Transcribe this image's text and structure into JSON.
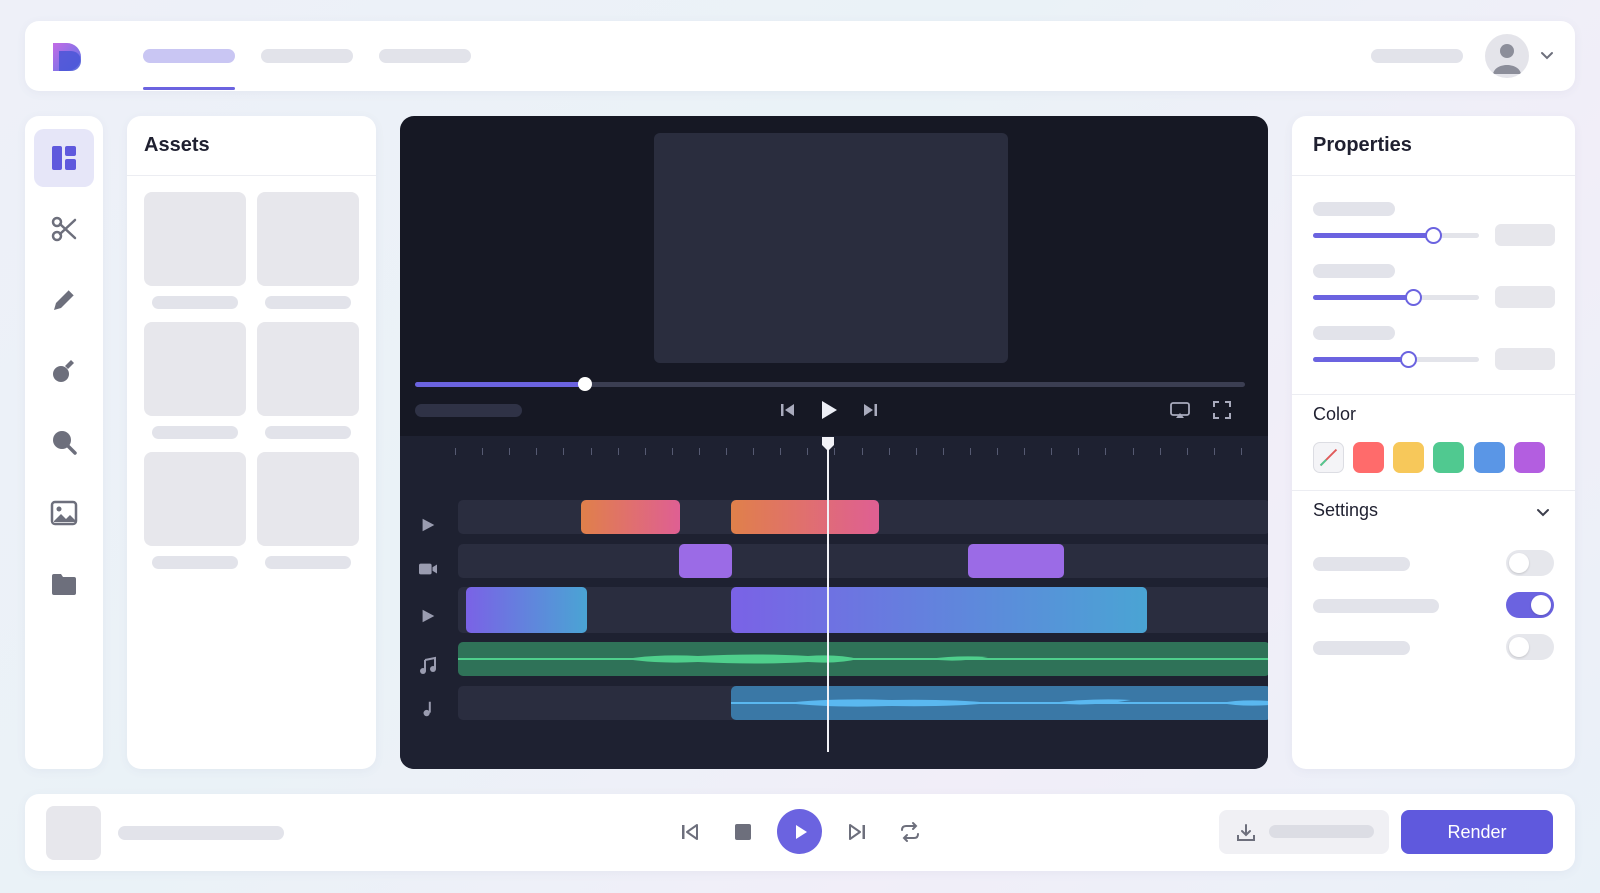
{
  "assets": {
    "title": "Assets"
  },
  "properties": {
    "title": "Properties",
    "color_label": "Color",
    "settings_label": "Settings"
  },
  "colors": {
    "accent": "#6b63e0",
    "swatches": [
      "#ff6b6b",
      "#f7c85a",
      "#50c990",
      "#5a96e6",
      "#b35ee0"
    ]
  },
  "sliders": [
    0.72,
    0.6,
    0.57
  ],
  "toggles": [
    false,
    true,
    false
  ],
  "scrubber": {
    "progress": 0.205
  },
  "bottom": {
    "render_label": "Render"
  },
  "icons": {
    "rail": [
      "layout-icon",
      "scissors-icon",
      "pencil-icon",
      "effects-icon",
      "magnifier-icon",
      "image-icon",
      "folder-icon"
    ],
    "tracks": [
      "play-icon",
      "video-camera-icon",
      "play-icon",
      "music-note-icon",
      "music-note-icon"
    ]
  }
}
